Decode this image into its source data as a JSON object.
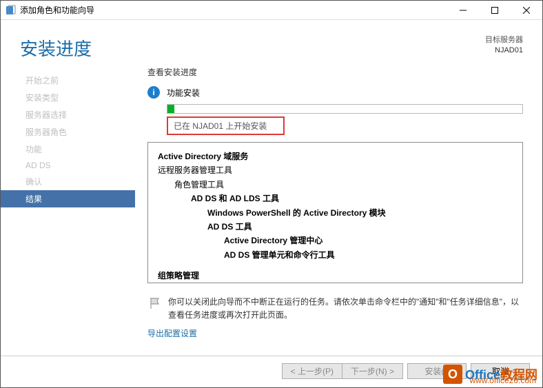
{
  "window": {
    "title": "添加角色和功能向导"
  },
  "header": {
    "page_title": "安装进度",
    "target_label": "目标服务器",
    "target_server": "NJAD01"
  },
  "sidebar": {
    "steps": [
      {
        "label": "开始之前"
      },
      {
        "label": "安装类型"
      },
      {
        "label": "服务器选择"
      },
      {
        "label": "服务器角色"
      },
      {
        "label": "功能"
      },
      {
        "label": "AD DS"
      },
      {
        "label": "确认"
      },
      {
        "label": "结果",
        "active": true
      }
    ]
  },
  "main": {
    "section_label": "查看安装进度",
    "status_text": "功能安装",
    "started_msg": "已在 NJAD01 上开始安装",
    "features": {
      "r0": "Active Directory 域服务",
      "r1": "远程服务器管理工具",
      "r2": "角色管理工具",
      "r3": "AD DS 和 AD LDS 工具",
      "r4": "Windows PowerShell 的 Active Directory 模块",
      "r5": "AD DS 工具",
      "r6": "Active Directory 管理中心",
      "r7": "AD DS 管理单元和命令行工具",
      "r8": "组策略管理"
    },
    "note_text": "你可以关闭此向导而不中断正在运行的任务。请依次单击命令栏中的\"通知\"和\"任务详细信息\"，以查看任务进度或再次打开此页面。",
    "export_link": "导出配置设置"
  },
  "buttons": {
    "prev": "< 上一步(P)",
    "next": "下一步(N) >",
    "install": "安装(I)",
    "cancel": "取消"
  },
  "watermark": {
    "brand1": "Office",
    "brand2": "教程网",
    "url": "www.office26.com"
  }
}
